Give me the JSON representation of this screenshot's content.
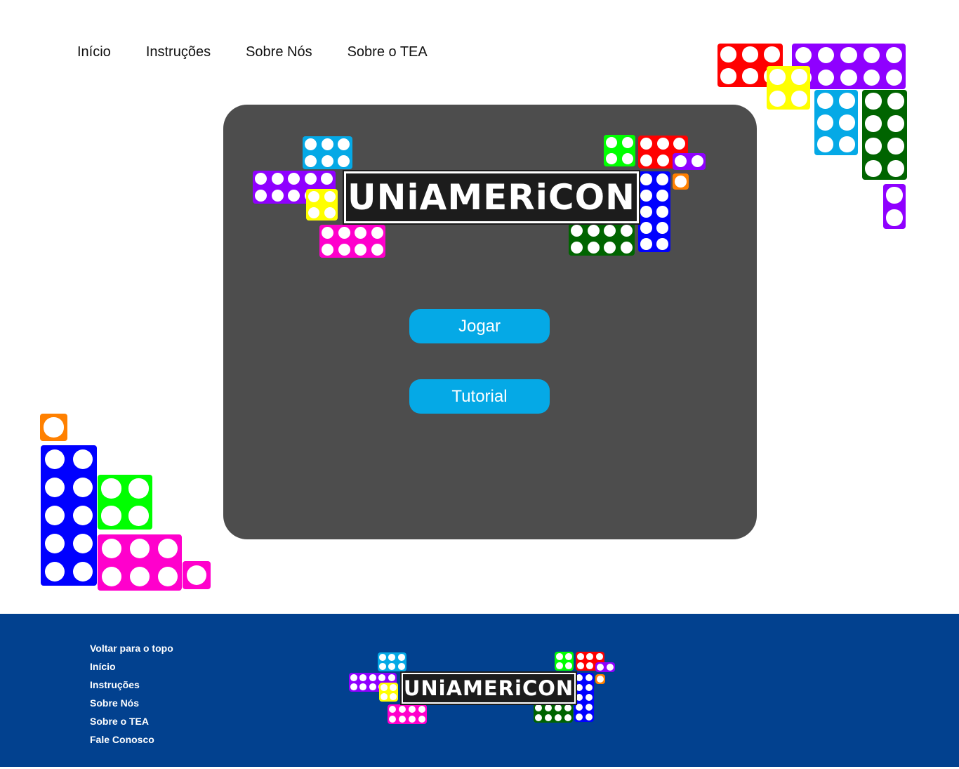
{
  "nav": {
    "items": [
      "Início",
      "Instruções",
      "Sobre Nós",
      "Sobre o TEA"
    ]
  },
  "logo": {
    "text": "UNiAMERiCON"
  },
  "main": {
    "play_label": "Jogar",
    "tutorial_label": "Tutorial"
  },
  "footer": {
    "links": [
      "Voltar para o topo",
      "Início",
      "Instruções",
      "Sobre Nós",
      "Sobre o TEA",
      "Fale Conosco"
    ]
  },
  "colors": {
    "panel": "#4d4d4d",
    "button": "#05a9e6",
    "footer": "#02418f",
    "red": "#ff0000",
    "purple": "#8f00ff",
    "yellow": "#ffff00",
    "cyan": "#05a9e6",
    "darkgreen": "#006400",
    "lime": "#00ff00",
    "blue": "#0000ff",
    "magenta": "#ff00cc",
    "orange": "#ff8000"
  }
}
